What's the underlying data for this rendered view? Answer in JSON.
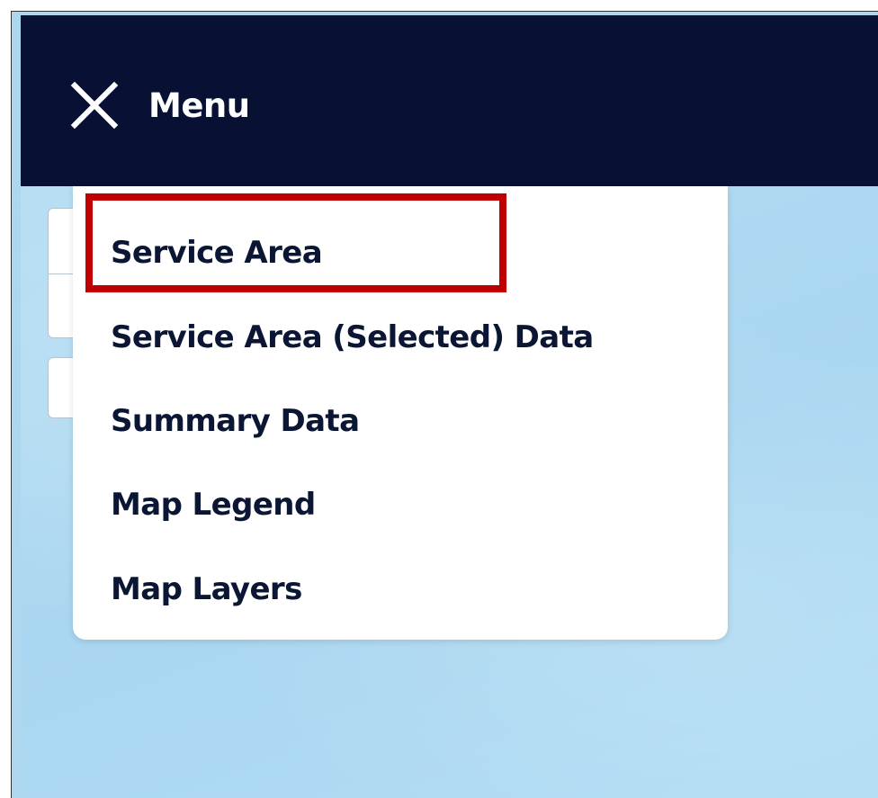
{
  "header": {
    "menu_label": "Menu",
    "close_icon": "close-icon",
    "background_color": "#081034"
  },
  "menu": {
    "items": [
      {
        "label": "Service Area",
        "highlighted": true
      },
      {
        "label": "Service Area (Selected) Data"
      },
      {
        "label": "Summary Data"
      },
      {
        "label": "Map Legend"
      },
      {
        "label": "Map Layers"
      }
    ],
    "highlight_color": "#c00000"
  },
  "map": {
    "background_color": "#add6ef",
    "controls": [
      "zoom-in-button",
      "zoom-out-button",
      "locate-button"
    ]
  }
}
